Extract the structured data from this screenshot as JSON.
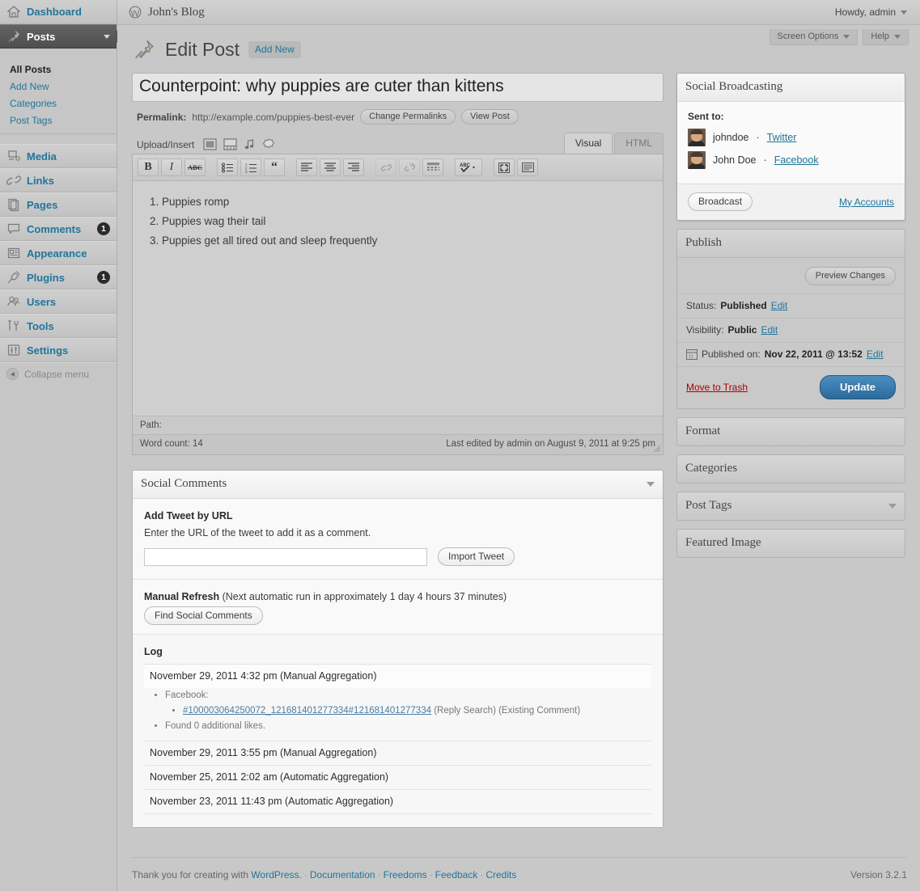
{
  "sidebar": {
    "items": [
      {
        "label": "Dashboard",
        "icon": "dashboard-icon",
        "badge": null,
        "current": false,
        "has_caret": false
      },
      {
        "label": "Posts",
        "icon": "pin-icon",
        "badge": null,
        "current": true,
        "has_caret": true
      },
      {
        "label": "Media",
        "icon": "media-icon",
        "badge": null,
        "current": false,
        "has_caret": false
      },
      {
        "label": "Links",
        "icon": "link-icon",
        "badge": null,
        "current": false,
        "has_caret": false
      },
      {
        "label": "Pages",
        "icon": "pages-icon",
        "badge": null,
        "current": false,
        "has_caret": false
      },
      {
        "label": "Comments",
        "icon": "comment-bubble-icon",
        "badge": "1",
        "current": false,
        "has_caret": false
      },
      {
        "label": "Appearance",
        "icon": "appearance-icon",
        "badge": null,
        "current": false,
        "has_caret": false
      },
      {
        "label": "Plugins",
        "icon": "plug-icon",
        "badge": "1",
        "current": false,
        "has_caret": false
      },
      {
        "label": "Users",
        "icon": "users-icon",
        "badge": null,
        "current": false,
        "has_caret": false
      },
      {
        "label": "Tools",
        "icon": "tools-icon",
        "badge": null,
        "current": false,
        "has_caret": false
      },
      {
        "label": "Settings",
        "icon": "settings-icon",
        "badge": null,
        "current": false,
        "has_caret": false
      }
    ],
    "posts_submenu": [
      {
        "label": "All Posts",
        "current": true
      },
      {
        "label": "Add New",
        "current": false
      },
      {
        "label": "Categories",
        "current": false
      },
      {
        "label": "Post Tags",
        "current": false
      }
    ],
    "collapse_label": "Collapse menu"
  },
  "adminbar": {
    "blog_name": "John's Blog",
    "howdy": "Howdy, admin"
  },
  "screen_meta": {
    "screen_options": "Screen Options",
    "help": "Help"
  },
  "page": {
    "title": "Edit Post",
    "add_new": "Add New"
  },
  "post": {
    "title_value": "Counterpoint: why puppies are cuter than kittens",
    "title_placeholder": "Enter title here",
    "permalink_label": "Permalink:",
    "permalink_url": "http://example.com/puppies-best-ever",
    "change_permalinks": "Change Permalinks",
    "view_post": "View Post",
    "content_items": [
      "Puppies romp",
      "Puppies wag their tail",
      "Puppies get all tired out and sleep frequently"
    ]
  },
  "editor": {
    "upload_insert_label": "Upload/Insert",
    "media_icons": [
      "add-image-icon",
      "add-video-icon",
      "add-audio-icon",
      "add-media-icon"
    ],
    "tabs": [
      {
        "label": "Visual",
        "active": true
      },
      {
        "label": "HTML",
        "active": false
      }
    ],
    "toolbar_buttons": [
      {
        "name": "bold-button",
        "glyph": "B"
      },
      {
        "name": "italic-button",
        "glyph": "I"
      },
      {
        "name": "strikethrough-button",
        "glyph": "ABC"
      },
      {
        "name": "unordered-list-button",
        "glyph": "list"
      },
      {
        "name": "ordered-list-button",
        "glyph": "numlist"
      },
      {
        "name": "blockquote-button",
        "glyph": "“"
      },
      {
        "name": "align-left-button",
        "glyph": "alignleft"
      },
      {
        "name": "align-center-button",
        "glyph": "aligncenter"
      },
      {
        "name": "align-right-button",
        "glyph": "alignright"
      },
      {
        "name": "insert-link-button",
        "glyph": "link"
      },
      {
        "name": "unlink-button",
        "glyph": "unlink"
      },
      {
        "name": "insert-more-tag-button",
        "glyph": "more"
      },
      {
        "name": "spellcheck-button",
        "glyph": "ABC-check"
      },
      {
        "name": "fullscreen-button",
        "glyph": "fullscreen"
      },
      {
        "name": "kitchen-sink-button",
        "glyph": "kitchensink"
      }
    ],
    "path_label": "Path:",
    "word_count": "Word count: 14",
    "last_edited": "Last edited by admin on August 9, 2011 at 9:25 pm"
  },
  "social_broadcasting": {
    "title": "Social Broadcasting",
    "sent_to_label": "Sent to:",
    "accounts": [
      {
        "name": "johndoe",
        "sep": "·",
        "network": "Twitter"
      },
      {
        "name": "John Doe",
        "sep": "·",
        "network": "Facebook"
      }
    ],
    "broadcast_button": "Broadcast",
    "my_accounts_link": "My Accounts"
  },
  "publish": {
    "title": "Publish",
    "preview_changes": "Preview Changes",
    "status_label": "Status:",
    "status_value": "Published",
    "status_edit": "Edit",
    "visibility_label": "Visibility:",
    "visibility_value": "Public",
    "visibility_edit": "Edit",
    "published_label": "Published on:",
    "published_value": "Nov 22, 2011 @ 13:52",
    "published_edit": "Edit",
    "move_to_trash": "Move to Trash",
    "update_button": "Update"
  },
  "side_boxes": [
    {
      "title": "Format",
      "has_toggle": false
    },
    {
      "title": "Categories",
      "has_toggle": false
    },
    {
      "title": "Post Tags",
      "has_toggle": true
    },
    {
      "title": "Featured Image",
      "has_toggle": false
    }
  ],
  "social_comments": {
    "title": "Social Comments",
    "add_tweet_heading": "Add Tweet by URL",
    "add_tweet_description": "Enter the URL of the tweet to add it as a comment.",
    "tweet_url_value": "",
    "tweet_url_placeholder": "",
    "import_tweet_button": "Import Tweet",
    "manual_refresh_label": "Manual Refresh",
    "manual_refresh_note": "(Next automatic run in approximately 1 day 4 hours 37 minutes)",
    "find_comments_button": "Find Social Comments",
    "log_title": "Log",
    "log_entries": [
      {
        "timestamp": "November 29, 2011 4:32 pm (Manual Aggregation)",
        "details": [
          {
            "label": "Facebook:",
            "children": [
              {
                "link": "#100003064250072_121681401277334#121681401277334",
                "suffix": "(Reply Search) (Existing Comment)"
              }
            ]
          },
          {
            "label": "Found 0 additional likes.",
            "children": []
          }
        ]
      },
      {
        "timestamp": "November 29, 2011 3:55 pm (Manual Aggregation)",
        "details": []
      },
      {
        "timestamp": "November 25, 2011 2:02 am (Automatic Aggregation)",
        "details": []
      },
      {
        "timestamp": "November 23, 2011 11:43 pm (Automatic Aggregation)",
        "details": []
      }
    ]
  },
  "footer": {
    "thanks": "Thank you for creating with",
    "wordpress_link": "WordPress.",
    "links": [
      "Documentation",
      "Freedoms",
      "Feedback",
      "Credits"
    ],
    "version": "Version 3.2.1"
  },
  "colors": {
    "link": "#21759b",
    "accent_button": "#2b6b9c",
    "trash": "#aa0000",
    "badge_bg": "#2b2b2b",
    "page_bg": "#c8c8c8"
  }
}
